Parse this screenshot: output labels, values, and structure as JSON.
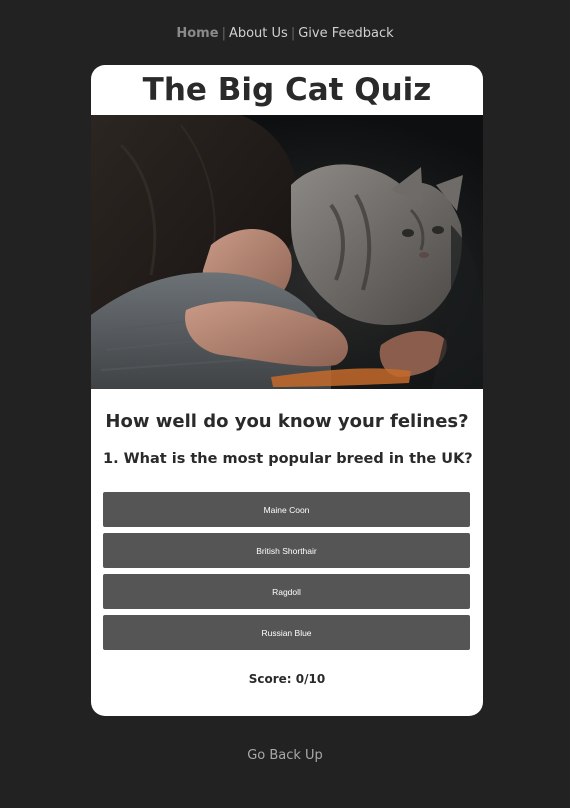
{
  "nav": {
    "home": "Home",
    "about": "About Us",
    "feedback": "Give Feedback",
    "separator": "|"
  },
  "quiz": {
    "title": "The Big Cat Quiz",
    "subtitle": "How well do you know your felines?",
    "question": "1. What is the most popular breed in the UK?",
    "answers": [
      "Maine Coon",
      "British Shorthair",
      "Ragdoll",
      "Russian Blue"
    ],
    "score_label": "Score:",
    "score_value": "0/10"
  },
  "footer": {
    "go_back": "Go Back Up"
  },
  "colors": {
    "page_background": "#222222",
    "card_background": "#ffffff",
    "button_background": "#555555",
    "heading_text": "#2a2a2a"
  }
}
